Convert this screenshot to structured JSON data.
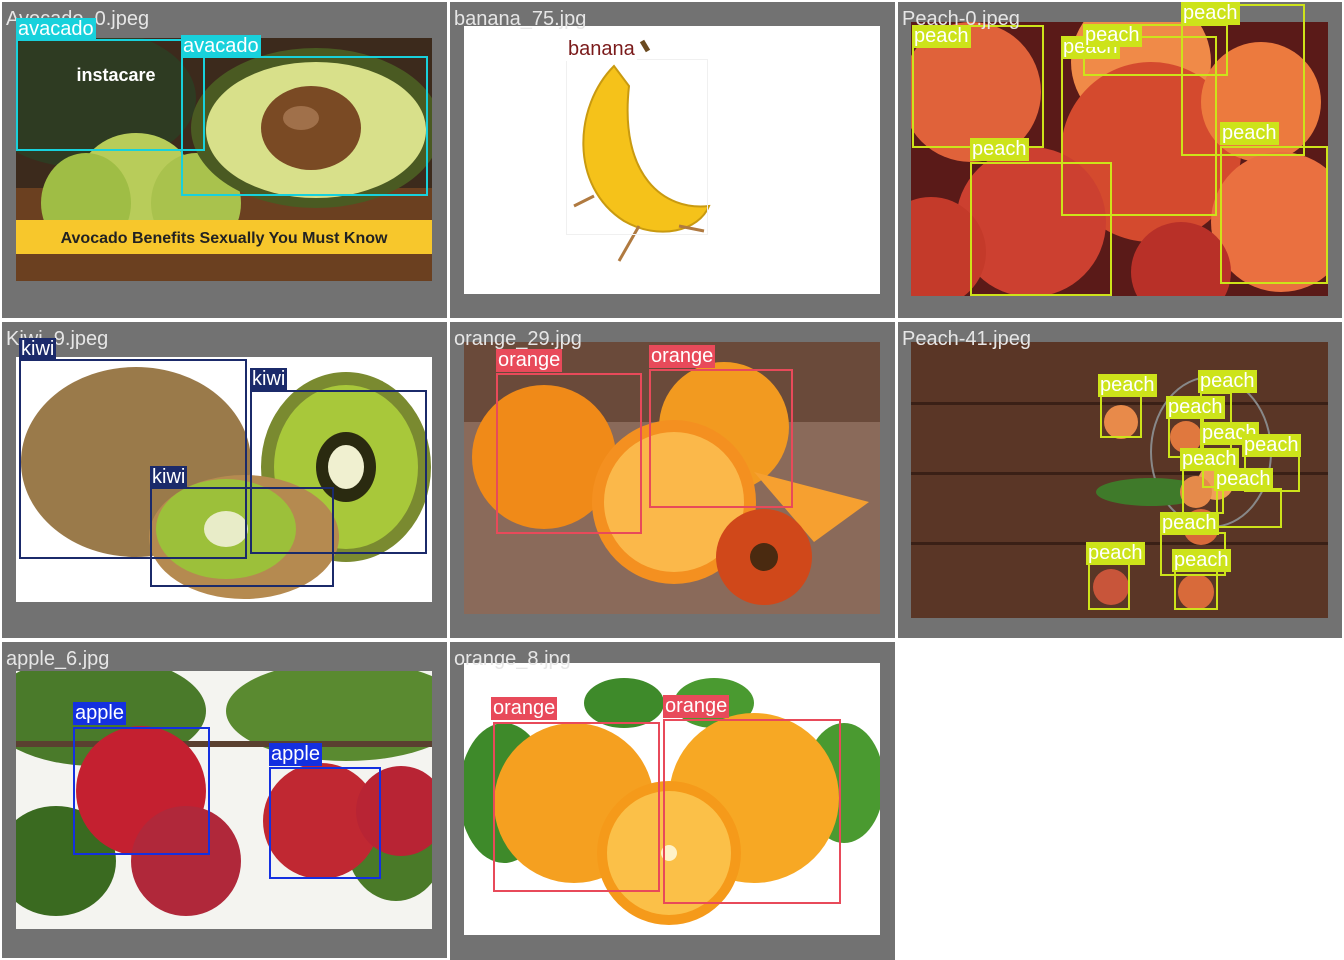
{
  "colors": {
    "avocado": "#18d1dc",
    "banana": "#ffffff",
    "peach": "#cde31a",
    "kiwi": "#1b2a6a",
    "orange": "#e84a5a",
    "apple": "#1430e0"
  },
  "tiles": [
    {
      "name": "Avocado_0.jpeg",
      "banner": "Avocado Benefits Sexually You Must Know",
      "watermark": "instacare",
      "detections": [
        "avacado",
        "avacado"
      ]
    },
    {
      "name": "banana_75.jpg",
      "detections": [
        "banana"
      ]
    },
    {
      "name": "Peach-0.jpeg",
      "detections": [
        "peach",
        "peach",
        "peach",
        "peach",
        "peach",
        "peach"
      ]
    },
    {
      "name": "Kiwi_9.jpeg",
      "detections": [
        "kiwi",
        "kiwi",
        "kiwi"
      ]
    },
    {
      "name": "orange_29.jpg",
      "detections": [
        "orange",
        "orange"
      ]
    },
    {
      "name": "Peach-41.jpeg",
      "detections": [
        "peach",
        "peach",
        "peach",
        "peach",
        "peach",
        "peach",
        "peach",
        "peach",
        "peach",
        "peach"
      ]
    },
    {
      "name": "apple_6.jpg",
      "detections": [
        "apple",
        "apple"
      ]
    },
    {
      "name": "orange_8.jpg",
      "detections": [
        "orange",
        "orange"
      ]
    }
  ]
}
